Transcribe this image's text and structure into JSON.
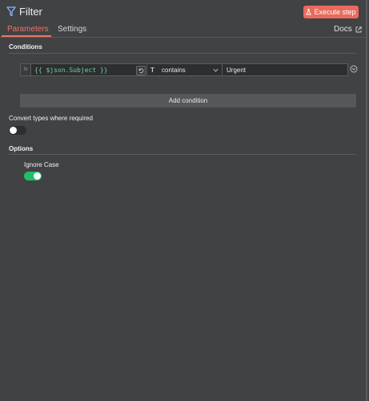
{
  "header": {
    "title": "Filter",
    "execute_label": "Execute step",
    "accent_color": "#ea6a5c"
  },
  "tabs": {
    "items": [
      {
        "label": "Parameters",
        "active": true
      },
      {
        "label": "Settings",
        "active": false
      }
    ],
    "docs_label": "Docs"
  },
  "conditions": {
    "section_label": "Conditions",
    "rows": [
      {
        "fx_label": "fx",
        "left_value": "{{ $json.Subject }}",
        "operator_type_icon": "T",
        "operator": "contains",
        "right_value": "Urgent"
      }
    ],
    "add_label": "Add condition"
  },
  "convert_types": {
    "label": "Convert types where required",
    "enabled": false
  },
  "options": {
    "section_label": "Options",
    "ignore_case": {
      "label": "Ignore Case",
      "enabled": true
    }
  },
  "icons": {
    "title": "filter-icon",
    "execute": "flask-icon",
    "docs": "external-link-icon",
    "swap": "swap-icon",
    "chevron": "chevron-down-icon",
    "remove": "remove-circle-icon"
  }
}
